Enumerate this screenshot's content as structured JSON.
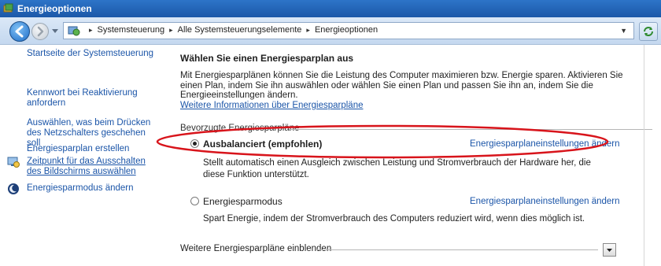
{
  "window": {
    "title": "Energieoptionen"
  },
  "address": {
    "crumbs": [
      "Systemsteuerung",
      "Alle Systemsteuerungselemente",
      "Energieoptionen"
    ]
  },
  "sidebar": {
    "items": [
      {
        "label": "Startseite der Systemsteuerung",
        "icon": ""
      },
      {
        "label": "Kennwort bei Reaktivierung anfordern",
        "icon": ""
      },
      {
        "label": "Auswählen, was beim Drücken des Netzschalters geschehen soll",
        "icon": ""
      },
      {
        "label": "Energiesparplan erstellen",
        "icon": ""
      },
      {
        "label": "Zeitpunkt für das Ausschalten des Bildschirms auswählen",
        "icon": "monitor-icon"
      },
      {
        "label": "Energiesparmodus ändern",
        "icon": "moon-icon"
      }
    ]
  },
  "main": {
    "heading": "Wählen Sie einen Energiesparplan aus",
    "intro": "Mit Energiesparplänen können Sie die Leistung des Computer maximieren bzw. Energie sparen. Aktivieren Sie einen Plan, indem Sie ihn auswählen oder wählen Sie einen Plan und passen Sie ihn an, indem Sie die Energieeinstellungen ändern.",
    "more_info_link": "Weitere Informationen über Energiesparpläne",
    "group_label": "Bevorzugte Energiesparpläne",
    "plans": [
      {
        "name": "Ausbalanciert (empfohlen)",
        "selected": true,
        "settings_link": "Energiesparplaneinstellungen ändern",
        "description": "Stellt automatisch einen Ausgleich zwischen Leistung und Stromverbrauch der Hardware her, die diese Funktion unterstützt."
      },
      {
        "name": "Energiesparmodus",
        "selected": false,
        "settings_link": "Energiesparplaneinstellungen ändern",
        "description": "Spart Energie, indem der Stromverbrauch des Computers reduziert wird, wenn dies möglich ist."
      }
    ],
    "more_plans_label": "Weitere Energiesparpläne einblenden"
  },
  "colors": {
    "link": "#1b55a8",
    "annotation": "#d8141b",
    "titlebar": "#1b58a8"
  }
}
